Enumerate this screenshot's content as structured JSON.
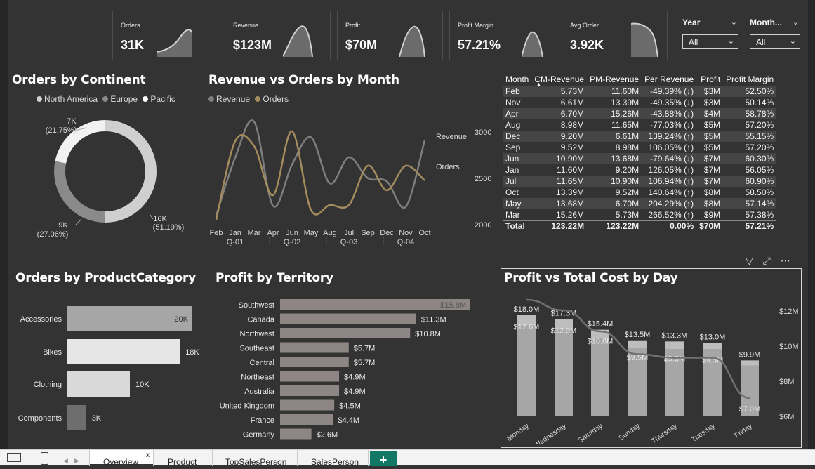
{
  "kpis": [
    {
      "label": "Orders",
      "value": "31K"
    },
    {
      "label": "Revenue",
      "value": "$123M"
    },
    {
      "label": "Profit",
      "value": "$70M"
    },
    {
      "label": "Profit Margin",
      "value": "57.21%"
    },
    {
      "label": "Avg Order",
      "value": "3.92K"
    }
  ],
  "slicers": {
    "year": {
      "title": "Year",
      "value": "All"
    },
    "month": {
      "title": "Month...",
      "value": "All"
    }
  },
  "orders_by_continent": {
    "title": "Orders by Continent",
    "legend": [
      "North America",
      "Europe",
      "Pacific"
    ],
    "labels": {
      "top_value": "7K",
      "top_pct": "(21.75%)",
      "right_value": "16K",
      "right_pct": "(51.19%)",
      "left_value": "9K",
      "left_pct": "(27.06%)"
    }
  },
  "revenue_vs_orders": {
    "title": "Revenue vs Orders by Month",
    "legend": [
      "Revenue",
      "Orders"
    ],
    "series_labels": {
      "revenue": "Revenue",
      "orders": "Orders"
    },
    "months": [
      "Feb",
      "Jan",
      "Mar",
      "Apr",
      "Jun",
      "May",
      "Aug",
      "Jul",
      "Sep",
      "Dec",
      "Nov",
      "Oct"
    ],
    "quarters": [
      "Q-01",
      "Q-02",
      "Q-03",
      "Q-04"
    ],
    "y_ticks": [
      "3000",
      "2500",
      "2000"
    ]
  },
  "matrix": {
    "headers": [
      "Month",
      "CM-Revenue",
      "PM-Revenue",
      "Per Revenue",
      "Profit",
      "Profit Margin"
    ],
    "rows": [
      [
        "Feb",
        "5.73M",
        "11.60M",
        "-49.39% (↓)",
        "$3M",
        "52.50%"
      ],
      [
        "Nov",
        "6.61M",
        "13.39M",
        "-49.35% (↓)",
        "$3M",
        "50.14%"
      ],
      [
        "Apr",
        "6.70M",
        "15.26M",
        "-43.88% (↓)",
        "$4M",
        "58.78%"
      ],
      [
        "Aug",
        "8.98M",
        "11.65M",
        "-77.03% (↓)",
        "$5M",
        "57.20%"
      ],
      [
        "Dec",
        "9.20M",
        "6.61M",
        "139.24% (↑)",
        "$5M",
        "55.15%"
      ],
      [
        "Sep",
        "9.52M",
        "8.98M",
        "106.05% (↑)",
        "$5M",
        "57.20%"
      ],
      [
        "Jun",
        "10.90M",
        "13.68M",
        "-79.64% (↓)",
        "$7M",
        "60.30%"
      ],
      [
        "Jan",
        "11.60M",
        "9.20M",
        "126.05% (↑)",
        "$7M",
        "56.05%"
      ],
      [
        "Jul",
        "11.65M",
        "10.90M",
        "106.94% (↑)",
        "$7M",
        "60.90%"
      ],
      [
        "Oct",
        "13.39M",
        "9.52M",
        "140.64% (↑)",
        "$8M",
        "58.50%"
      ],
      [
        "May",
        "13.68M",
        "6.70M",
        "204.29% (↑)",
        "$8M",
        "57.14%"
      ],
      [
        "Mar",
        "15.26M",
        "5.73M",
        "266.52% (↑)",
        "$9M",
        "57.38%"
      ]
    ],
    "total": [
      "Total",
      "123.22M",
      "123.22M",
      "0.00%",
      "$70M",
      "57.21%"
    ]
  },
  "product_category": {
    "title": "Orders by ProductCategory",
    "items": [
      {
        "label": "Accessories",
        "value": 20,
        "text": "20K"
      },
      {
        "label": "Bikes",
        "value": 18,
        "text": "18K"
      },
      {
        "label": "Clothing",
        "value": 10,
        "text": "10K"
      },
      {
        "label": "Components",
        "value": 3,
        "text": "3K"
      }
    ]
  },
  "territory": {
    "title": "Profit by Territory",
    "items": [
      {
        "label": "Southwest",
        "value": 15.8,
        "text": "$15.8M"
      },
      {
        "label": "Canada",
        "value": 11.3,
        "text": "$11.3M"
      },
      {
        "label": "Northwest",
        "value": 10.8,
        "text": "$10.8M"
      },
      {
        "label": "Southeast",
        "value": 5.7,
        "text": "$5.7M"
      },
      {
        "label": "Central",
        "value": 5.7,
        "text": "$5.7M"
      },
      {
        "label": "Northeast",
        "value": 4.9,
        "text": "$4.9M"
      },
      {
        "label": "Australia",
        "value": 4.9,
        "text": "$4.9M"
      },
      {
        "label": "United Kingdom",
        "value": 4.5,
        "text": "$4.5M"
      },
      {
        "label": "France",
        "value": 4.4,
        "text": "$4.4M"
      },
      {
        "label": "Germany",
        "value": 2.6,
        "text": "$2.6M"
      }
    ]
  },
  "profit_cost": {
    "title": "Profit vs Total Cost by Day",
    "days": [
      "Monday",
      "Wednesday",
      "Saturday",
      "Sunday",
      "Thursday",
      "Tuesday",
      "Friday"
    ],
    "y_ticks": [
      "$12M",
      "$10M",
      "$8M",
      "$6M"
    ]
  },
  "icons": [
    "filter-icon",
    "focus-mode-icon",
    "more-options-icon"
  ],
  "tabs": [
    "Overview",
    "Product",
    "TopSalesPerson",
    "SalesPerson"
  ],
  "tab_close": "x",
  "add_tab": "+",
  "chart_data": [
    {
      "type": "pie",
      "title": "Orders by Continent",
      "categories": [
        "North America",
        "Europe",
        "Pacific"
      ],
      "values": [
        16,
        9,
        7
      ],
      "labels": [
        "16K (51.19%)",
        "9K (27.06%)",
        "7K (21.75%)"
      ]
    },
    {
      "type": "line",
      "title": "Revenue vs Orders by Month",
      "categories": [
        "Feb",
        "Jan",
        "Mar",
        "Apr",
        "Jun",
        "May",
        "Aug",
        "Jul",
        "Sep",
        "Dec",
        "Nov",
        "Oct"
      ],
      "series": [
        {
          "name": "Revenue",
          "values": [
            5.73,
            11.6,
            15.26,
            6.7,
            10.9,
            13.68,
            8.98,
            11.65,
            9.52,
            9.2,
            6.61,
            13.39
          ]
        },
        {
          "name": "Orders",
          "values": [
            2050,
            2850,
            2800,
            2300,
            2950,
            2150,
            2200,
            2200,
            2600,
            2350,
            2600,
            2450
          ]
        }
      ],
      "ylim": [
        2000,
        3000
      ]
    },
    {
      "type": "bar",
      "title": "Orders by ProductCategory",
      "categories": [
        "Accessories",
        "Bikes",
        "Clothing",
        "Components"
      ],
      "values": [
        20,
        18,
        10,
        3
      ]
    },
    {
      "type": "bar",
      "title": "Profit by Territory",
      "categories": [
        "Southwest",
        "Canada",
        "Northwest",
        "Southeast",
        "Central",
        "Northeast",
        "Australia",
        "United Kingdom",
        "France",
        "Germany"
      ],
      "values": [
        15.8,
        11.3,
        10.8,
        5.7,
        5.7,
        4.9,
        4.9,
        4.5,
        4.4,
        2.6
      ]
    },
    {
      "type": "bar",
      "title": "Profit vs Total Cost by Day",
      "categories": [
        "Monday",
        "Wednesday",
        "Saturday",
        "Sunday",
        "Thursday",
        "Tuesday",
        "Friday"
      ],
      "series": [
        {
          "values": [
            18.0,
            17.3,
            15.4,
            13.5,
            13.3,
            13.0,
            9.9
          ],
          "labels": [
            "$18.0M",
            "$17.3M",
            "$15.4M",
            "$13.5M",
            "$13.3M",
            "$13.0M",
            "$9.9M"
          ]
        },
        {
          "values": [
            12.6,
            12.0,
            10.8,
            9.5,
            9.3,
            9.3,
            7.0
          ],
          "labels": [
            "$12.6M",
            "$12.0M",
            "$10.8M",
            "$9.5M",
            "$9.3M",
            "$9.3M",
            "$7.0M"
          ]
        }
      ],
      "ylim": [
        6,
        12
      ]
    }
  ]
}
